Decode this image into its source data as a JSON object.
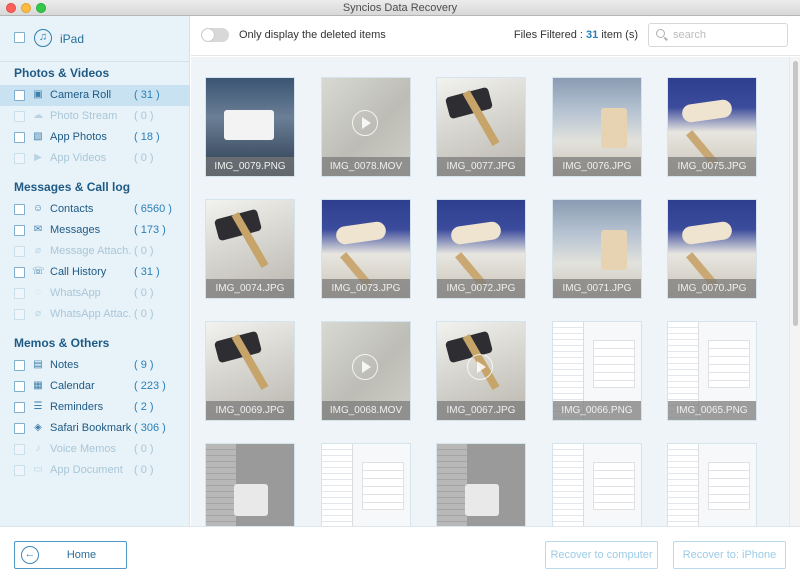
{
  "window": {
    "title": "Syncios Data Recovery"
  },
  "device": {
    "name": "iPad"
  },
  "sidebar": {
    "sections": [
      {
        "title": "Photos & Videos"
      },
      {
        "title": "Messages & Call log"
      },
      {
        "title": "Memos & Others"
      }
    ],
    "items": [
      {
        "label": "Camera Roll",
        "count": "( 31 )",
        "icon": "camera-icon",
        "enabled": true,
        "selected": true
      },
      {
        "label": "Photo Stream",
        "count": "( 0 )",
        "icon": "cloud-icon",
        "enabled": false
      },
      {
        "label": "App Photos",
        "count": "( 18 )",
        "icon": "image-icon",
        "enabled": true
      },
      {
        "label": "App Videos",
        "count": "( 0 )",
        "icon": "video-icon",
        "enabled": false
      },
      {
        "label": "Contacts",
        "count": "( 6560 )",
        "icon": "contacts-icon",
        "enabled": true
      },
      {
        "label": "Messages",
        "count": "( 173 )",
        "icon": "message-icon",
        "enabled": true
      },
      {
        "label": "Message Attach...",
        "count": "( 0 )",
        "icon": "attachment-icon",
        "enabled": false
      },
      {
        "label": "Call History",
        "count": "( 31 )",
        "icon": "phone-icon",
        "enabled": true
      },
      {
        "label": "WhatsApp",
        "count": "( 0 )",
        "icon": "whatsapp-icon",
        "enabled": false
      },
      {
        "label": "WhatsApp Attac...",
        "count": "( 0 )",
        "icon": "attachment-icon",
        "enabled": false
      },
      {
        "label": "Notes",
        "count": "( 9 )",
        "icon": "notes-icon",
        "enabled": true
      },
      {
        "label": "Calendar",
        "count": "( 223 )",
        "icon": "calendar-icon",
        "enabled": true
      },
      {
        "label": "Reminders",
        "count": "( 2 )",
        "icon": "reminders-icon",
        "enabled": true
      },
      {
        "label": "Safari Bookmark",
        "count": "( 306 )",
        "icon": "bookmark-icon",
        "enabled": true
      },
      {
        "label": "Voice Memos",
        "count": "( 0 )",
        "icon": "microphone-icon",
        "enabled": false
      },
      {
        "label": "App Document",
        "count": "( 0 )",
        "icon": "document-icon",
        "enabled": false
      }
    ]
  },
  "toolbar": {
    "toggle_label": "Only display the deleted items",
    "files_filtered_prefix": "Files Filtered : ",
    "files_filtered_count": "31",
    "files_filtered_suffix": " item (s)",
    "search_placeholder": "search"
  },
  "files": [
    {
      "name": "IMG_0079.PNG",
      "style": "ipad"
    },
    {
      "name": "IMG_0078.MOV",
      "style": "video"
    },
    {
      "name": "IMG_0077.JPG",
      "style": "desk"
    },
    {
      "name": "IMG_0076.JPG",
      "style": "office"
    },
    {
      "name": "IMG_0075.JPG",
      "style": "blue"
    },
    {
      "name": "IMG_0074.JPG",
      "style": "desk"
    },
    {
      "name": "IMG_0073.JPG",
      "style": "blue"
    },
    {
      "name": "IMG_0072.JPG",
      "style": "blue"
    },
    {
      "name": "IMG_0071.JPG",
      "style": "office"
    },
    {
      "name": "IMG_0070.JPG",
      "style": "blue"
    },
    {
      "name": "IMG_0069.JPG",
      "style": "desk"
    },
    {
      "name": "IMG_0068.MOV",
      "style": "video"
    },
    {
      "name": "IMG_0067.JPG",
      "style": "desk"
    },
    {
      "name": "IMG_0066.PNG",
      "style": "settings"
    },
    {
      "name": "IMG_0065.PNG",
      "style": "settings"
    },
    {
      "name": "",
      "style": "settings-dark"
    },
    {
      "name": "",
      "style": "settings"
    },
    {
      "name": "",
      "style": "settings-dark"
    },
    {
      "name": "",
      "style": "settings"
    },
    {
      "name": "",
      "style": "settings"
    }
  ],
  "footer": {
    "home_label": "Home",
    "recover_computer_label": "Recover to computer",
    "recover_device_label": "Recover to: iPhone"
  }
}
